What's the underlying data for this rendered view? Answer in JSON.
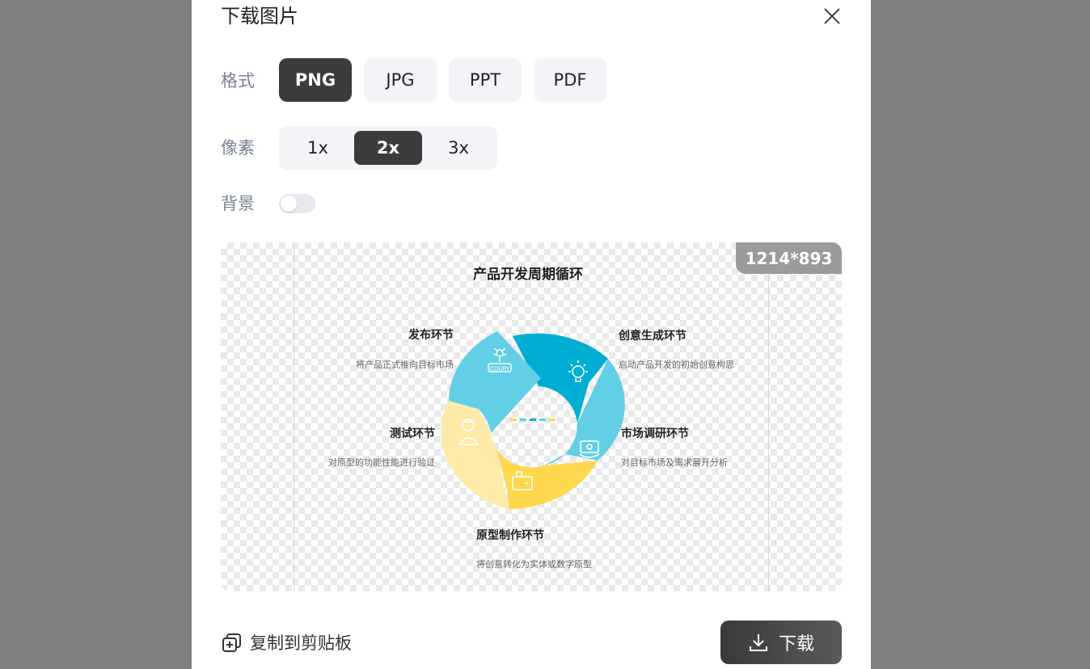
{
  "dialog": {
    "title": "下载图片",
    "format_label": "格式",
    "formats": [
      "PNG",
      "JPG",
      "PPT",
      "PDF"
    ],
    "selected_format": "PNG",
    "pixel_label": "像素",
    "pixel_options": [
      "1x",
      "2x",
      "3x"
    ],
    "selected_pixel": "2x",
    "background_label": "背景",
    "background_on": false,
    "size_badge": "1214*893",
    "copy_label": "复制到剪贴板",
    "download_label": "下载"
  },
  "infographic": {
    "title": "产品开发周期循环",
    "stages": [
      {
        "name": "创意生成环节",
        "desc": "启动产品开发的初始创意构思"
      },
      {
        "name": "市场调研环节",
        "desc": "对目标市场及需求展开分析"
      },
      {
        "name": "原型制作环节",
        "desc": "将创意转化为实体或数字原型"
      },
      {
        "name": "测试环节",
        "desc": "对原型的功能性能进行验证"
      },
      {
        "name": "发布环节",
        "desc": "将产品正式推向目标市场"
      }
    ],
    "icon_text": "COURY",
    "colors": {
      "dark_blue": "#00AED4",
      "light_blue": "#62CFE6",
      "yellow": "#FFD84D",
      "light_yellow": "#FFEBA7"
    }
  }
}
